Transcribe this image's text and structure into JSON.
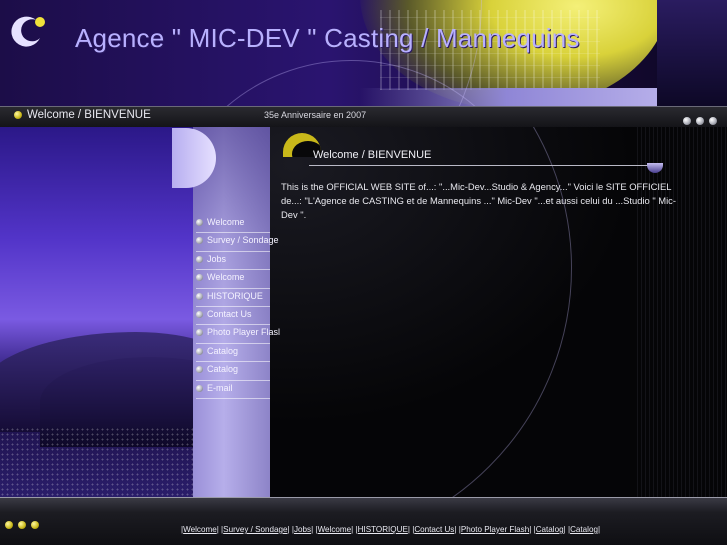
{
  "header": {
    "title": "Agence \" MIC-DEV \" Casting / Mannequins"
  },
  "topbar": {
    "welcome": "Welcome / BIENVENUE",
    "anniversary": "35e Anniversaire en 2007"
  },
  "nav": {
    "items": [
      {
        "label": "Welcome"
      },
      {
        "label": "Survey / Sondage"
      },
      {
        "label": "Jobs"
      },
      {
        "label": "Welcome"
      },
      {
        "label": "HISTORIQUE"
      },
      {
        "label": "Contact Us"
      },
      {
        "label": "Photo Player Flasl"
      },
      {
        "label": "Catalog"
      },
      {
        "label": "Catalog"
      },
      {
        "label": "E-mail"
      }
    ]
  },
  "content": {
    "heading": "Welcome / BIENVENUE",
    "body": "This is the OFFICIAL WEB SITE of...: \"...Mic-Dev...Studio & Agency...\" Voici le SITE OFFICIEL de...: \"L'Agence de CASTING et de Mannequins ...\" Mic-Dev \"...et aussi celui du ...Studio \" Mic-Dev \"."
  },
  "footer": {
    "links": [
      {
        "label": "Welcome"
      },
      {
        "label": "Survey / Sondage"
      },
      {
        "label": "Jobs"
      },
      {
        "label": "Welcome"
      },
      {
        "label": "HISTORIQUE"
      },
      {
        "label": "Contact Us"
      },
      {
        "label": "Photo Player Flash"
      },
      {
        "label": "Catalog"
      },
      {
        "label": "Catalog"
      }
    ]
  },
  "colors": {
    "title": "#b8b0ff",
    "accent_yellow": "#c9b81a",
    "nav_column": "#b6aeea"
  },
  "icons": {
    "logo": "crescent-logo-icon",
    "bullet": "gray-orb-icon",
    "topbar_bullet": "yellow-orb-icon"
  }
}
